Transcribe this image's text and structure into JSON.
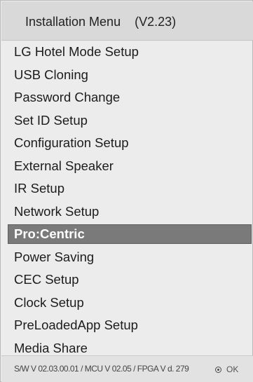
{
  "menu": {
    "title": "Installation Menu    (V2.23)",
    "items": [
      {
        "label": "LG Hotel Mode Setup",
        "selected": false
      },
      {
        "label": "USB Cloning",
        "selected": false
      },
      {
        "label": "Password Change",
        "selected": false
      },
      {
        "label": "Set ID Setup",
        "selected": false
      },
      {
        "label": "Configuration Setup",
        "selected": false
      },
      {
        "label": "External Speaker",
        "selected": false
      },
      {
        "label": "IR Setup",
        "selected": false
      },
      {
        "label": "Network Setup",
        "selected": false
      },
      {
        "label": "Pro:Centric",
        "selected": true
      },
      {
        "label": "Power Saving",
        "selected": false
      },
      {
        "label": "CEC Setup",
        "selected": false
      },
      {
        "label": "Clock Setup",
        "selected": false
      },
      {
        "label": "PreLoadedApp Setup",
        "selected": false
      },
      {
        "label": "Media Share",
        "selected": false
      }
    ]
  },
  "footer": {
    "version": "S/W V 02.03.00.01 / MCU V 02.05 / FPGA V d. 279",
    "ok_icon": "ok-button-icon",
    "ok_label": "OK"
  },
  "colors": {
    "selected_bg": "#7a7a7a",
    "selected_text": "#ffffff",
    "menu_bg": "#ececec",
    "title_bg": "#d9d9d9"
  }
}
